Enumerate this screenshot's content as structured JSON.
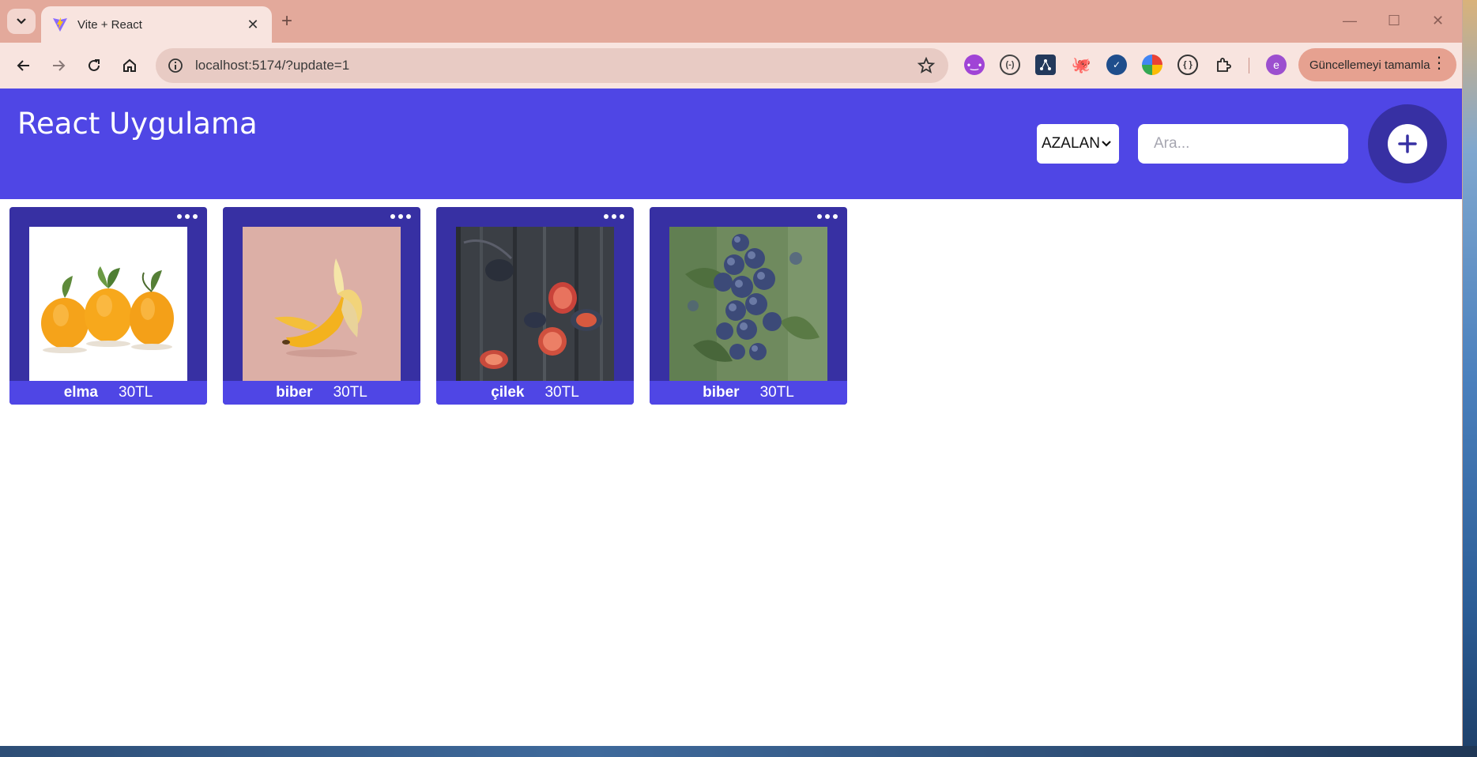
{
  "browser": {
    "tab_title": "Vite + React",
    "url": "localhost:5174/?update=1",
    "update_button": "Güncellemeyi tamamla",
    "profile_initial": "e",
    "extensions": [
      "ext-purple-icon",
      "ext-bracket-icon",
      "ext-graph-icon",
      "ext-octopus-icon",
      "ext-check-icon",
      "ext-colorwheel-icon",
      "ext-braces-icon",
      "extensions-puzzle-icon"
    ]
  },
  "app": {
    "title": "React Uygulama",
    "sort": {
      "selected": "AZALAN"
    },
    "search": {
      "placeholder": "Ara..."
    },
    "add_button_icon": "plus-icon"
  },
  "products": [
    {
      "name": "elma",
      "price": "30TL",
      "image": "oranges"
    },
    {
      "name": "biber",
      "price": "30TL",
      "image": "banana"
    },
    {
      "name": "çilek",
      "price": "30TL",
      "image": "figs"
    },
    {
      "name": "biber",
      "price": "30TL",
      "image": "blueberries"
    }
  ],
  "colors": {
    "header": "#4f46e5",
    "card": "#3730a3",
    "tabbar": "#e3a99b",
    "toolbar": "#f8e4df"
  }
}
